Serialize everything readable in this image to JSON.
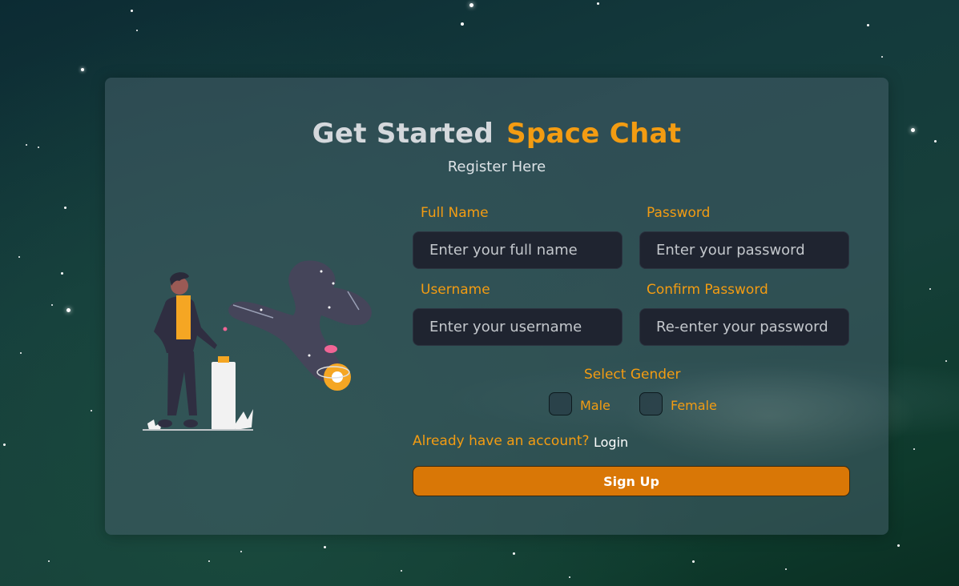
{
  "title": {
    "part1": "Get Started",
    "part2": "Space Chat"
  },
  "subtitle": "Register Here",
  "form": {
    "full_name": {
      "label": "Full Name",
      "placeholder": "Enter your full name"
    },
    "password": {
      "label": "Password",
      "placeholder": "Enter your password"
    },
    "username": {
      "label": "Username",
      "placeholder": "Enter your username"
    },
    "confirm_password": {
      "label": "Confirm Password",
      "placeholder": "Re-enter your password"
    },
    "gender": {
      "label": "Select Gender",
      "options": [
        "Male",
        "Female"
      ]
    },
    "account_prompt": "Already have an account?",
    "login_link": "Login",
    "submit": "Sign Up"
  },
  "colors": {
    "accent": "#f39c12",
    "button": "#d97706",
    "input_bg": "#1f2430"
  }
}
